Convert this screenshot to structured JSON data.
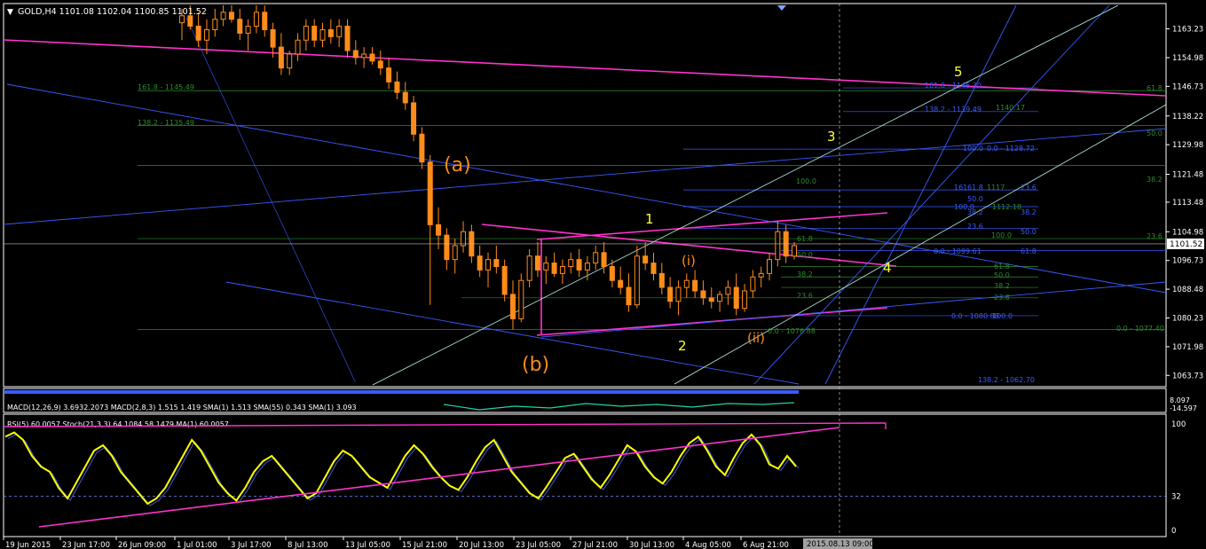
{
  "chart_data": {
    "type": "candlestick",
    "symbol_header": {
      "symbol": "GOLD,H4",
      "open": "1101.08",
      "high": "1102.04",
      "low": "1100.85",
      "close": "1101.52"
    },
    "main_panel": {
      "ylim": [
        1061.0,
        1170.0
      ],
      "tick_labels": [
        "1163.23",
        "1154.98",
        "1146.73",
        "1138.22",
        "1129.98",
        "1121.48",
        "1113.48",
        "1104.98",
        "1096.73",
        "1088.48",
        "1080.23",
        "1071.98",
        "1063.73"
      ],
      "tick_values": [
        1163.23,
        1154.98,
        1146.73,
        1138.22,
        1129.98,
        1121.48,
        1113.48,
        1104.98,
        1096.73,
        1088.48,
        1080.23,
        1071.98,
        1063.73
      ],
      "current_price_label": "1101.52",
      "current_price": 1101.52,
      "candles": [
        [
          1165,
          1169,
          1160,
          1167
        ],
        [
          1167,
          1170,
          1163,
          1164
        ],
        [
          1164,
          1168,
          1158,
          1160
        ],
        [
          1160,
          1166,
          1156,
          1163
        ],
        [
          1163,
          1169,
          1161,
          1166
        ],
        [
          1166,
          1170,
          1164,
          1168
        ],
        [
          1168,
          1170,
          1165,
          1166
        ],
        [
          1166,
          1169,
          1160,
          1162
        ],
        [
          1162,
          1166,
          1157,
          1164
        ],
        [
          1164,
          1170,
          1162,
          1168
        ],
        [
          1168,
          1170,
          1161,
          1163
        ],
        [
          1163,
          1165,
          1155,
          1158
        ],
        [
          1158,
          1162,
          1150,
          1152
        ],
        [
          1152,
          1157,
          1150,
          1156
        ],
        [
          1156,
          1162,
          1154,
          1160
        ],
        [
          1160,
          1166,
          1157,
          1164
        ],
        [
          1164,
          1166,
          1158,
          1160
        ],
        [
          1160,
          1165,
          1158,
          1163
        ],
        [
          1163,
          1166,
          1159,
          1161
        ],
        [
          1161,
          1166,
          1158,
          1164
        ],
        [
          1164,
          1166,
          1155,
          1157
        ],
        [
          1157,
          1160,
          1153,
          1155
        ],
        [
          1155,
          1158,
          1152,
          1156
        ],
        [
          1156,
          1158,
          1153,
          1154
        ],
        [
          1154,
          1157,
          1150,
          1152
        ],
        [
          1152,
          1155,
          1146,
          1148
        ],
        [
          1148,
          1151,
          1143,
          1145
        ],
        [
          1145,
          1148,
          1140,
          1142
        ],
        [
          1142,
          1144,
          1131,
          1133
        ],
        [
          1133,
          1135,
          1123,
          1125
        ],
        [
          1125,
          1127,
          1084,
          1107
        ],
        [
          1107,
          1112,
          1100,
          1104
        ],
        [
          1104,
          1106,
          1094,
          1097
        ],
        [
          1097,
          1103,
          1093,
          1101
        ],
        [
          1101,
          1108,
          1099,
          1105
        ],
        [
          1105,
          1107,
          1096,
          1098
        ],
        [
          1098,
          1101,
          1092,
          1094
        ],
        [
          1094,
          1099,
          1089,
          1097
        ],
        [
          1097,
          1101,
          1093,
          1095
        ],
        [
          1095,
          1097,
          1085,
          1087
        ],
        [
          1087,
          1091,
          1077,
          1080
        ],
        [
          1080,
          1093,
          1079,
          1091
        ],
        [
          1091,
          1100,
          1089,
          1098
        ],
        [
          1098,
          1102,
          1092,
          1094
        ],
        [
          1094,
          1098,
          1090,
          1096
        ],
        [
          1096,
          1099,
          1092,
          1093
        ],
        [
          1093,
          1097,
          1090,
          1095
        ],
        [
          1095,
          1099,
          1093,
          1097
        ],
        [
          1097,
          1100,
          1092,
          1094
        ],
        [
          1094,
          1098,
          1091,
          1096
        ],
        [
          1096,
          1101,
          1094,
          1099
        ],
        [
          1099,
          1102,
          1093,
          1095
        ],
        [
          1095,
          1097,
          1089,
          1091
        ],
        [
          1091,
          1095,
          1087,
          1089
        ],
        [
          1089,
          1093,
          1082,
          1084
        ],
        [
          1084,
          1101,
          1083,
          1098
        ],
        [
          1098,
          1102,
          1094,
          1096
        ],
        [
          1096,
          1099,
          1091,
          1093
        ],
        [
          1093,
          1096,
          1087,
          1089
        ],
        [
          1089,
          1092,
          1083,
          1085
        ],
        [
          1085,
          1091,
          1081,
          1089
        ],
        [
          1089,
          1093,
          1086,
          1091
        ],
        [
          1091,
          1094,
          1086,
          1088
        ],
        [
          1088,
          1091,
          1084,
          1086
        ],
        [
          1086,
          1089,
          1083,
          1085
        ],
        [
          1085,
          1088,
          1082,
          1087
        ],
        [
          1087,
          1091,
          1084,
          1089
        ],
        [
          1089,
          1093,
          1081,
          1083
        ],
        [
          1083,
          1090,
          1082,
          1088
        ],
        [
          1088,
          1094,
          1086,
          1092
        ],
        [
          1092,
          1095,
          1089,
          1093
        ],
        [
          1093,
          1099,
          1091,
          1097
        ],
        [
          1097,
          1108,
          1095,
          1105
        ],
        [
          1105,
          1107,
          1096,
          1098
        ],
        [
          1098,
          1102,
          1097,
          1101
        ]
      ],
      "fib_labels": [
        "161.8 - 1145.49",
        "138.2 - 1135.49",
        "100.0",
        "161.8 - 1146.30",
        "138.2 - 1139.49",
        "1140.17",
        "100.0",
        "0.0 - 1128.72",
        "161",
        "61.8",
        "1117",
        "23.6",
        "50.0",
        "100.0",
        "1112.18",
        "38.2",
        "38.2",
        "23.6",
        "50.0",
        "100.0",
        "61.8",
        "0.0 - 1099.61",
        "61.8",
        "50.0",
        "38.2",
        "23.6",
        "61.8",
        "50.0",
        "38.2",
        "23.6",
        "0.0 - 1080.88",
        "100.0",
        "0.0 - 1076.88",
        "0.0 - 1077.40",
        "138.2 - 1062.70",
        "61.8",
        "50.0",
        "38.2",
        "23.6"
      ],
      "wave_labels": [
        "(a)",
        "(b)",
        "1",
        "2",
        "3",
        "4",
        "5",
        "(i)",
        "(ii)"
      ]
    },
    "macd_panel": {
      "legend": "MACD(12,26,9) 3.6932.2073 MACD(2,8,3) 1.515 1.419 SMA(1) 1.513 SMA(55) 0.343 SMA(1) 3.093",
      "tick_labels": [
        "8.097",
        "-14.597"
      ]
    },
    "rsi_panel": {
      "legend": "RSI(5) 60.0057 Stoch(21,3,3) 64.1084 58.1479 MA(1) 60.0057",
      "ylim": [
        0,
        100
      ],
      "tick_labels": [
        "100",
        "32",
        "0"
      ],
      "tick_values": [
        100,
        32,
        0
      ],
      "values": [
        88,
        92,
        85,
        70,
        60,
        55,
        40,
        30,
        45,
        60,
        75,
        80,
        70,
        55,
        45,
        35,
        25,
        30,
        40,
        55,
        70,
        85,
        75,
        60,
        45,
        35,
        28,
        40,
        55,
        65,
        70,
        60,
        50,
        40,
        30,
        35,
        50,
        65,
        75,
        70,
        60,
        50,
        45,
        40,
        55,
        70,
        80,
        72,
        60,
        50,
        42,
        38,
        50,
        65,
        78,
        85,
        70,
        55,
        45,
        35,
        30,
        42,
        55,
        68,
        72,
        60,
        48,
        40,
        52,
        66,
        80,
        74,
        60,
        50,
        44,
        55,
        70,
        82,
        88,
        75,
        60,
        52,
        68,
        82,
        90,
        80,
        62,
        58,
        70,
        60
      ]
    },
    "x_axis": {
      "tick_labels": [
        "19 Jun 2015",
        "23 Jun 17:00",
        "26 Jun 09:00",
        "1 Jul 01:00",
        "3 Jul 17:00",
        "8 Jul 13:00",
        "13 Jul 05:00",
        "15 Jul 21:00",
        "20 Jul 13:00",
        "23 Jul 05:00",
        "27 Jul 21:00",
        "30 Jul 13:00",
        "4 Aug 05:00",
        "6 Aug 21:00"
      ],
      "cursor_label": "2015.08.13 09:00"
    },
    "colors": {
      "background": "#000000",
      "bull": "#ff8c1a",
      "bear": "#ff8c1a",
      "magenta": "#ff33cc",
      "blue": "#3a5bff",
      "fib_green": "#2e8b2e",
      "teal": "#b8f2e6",
      "yellow_wave": "#ffff33",
      "orange_wave": "#ff8c1a",
      "axis_text": "#ffffff",
      "rsi": "#ffff00"
    }
  }
}
